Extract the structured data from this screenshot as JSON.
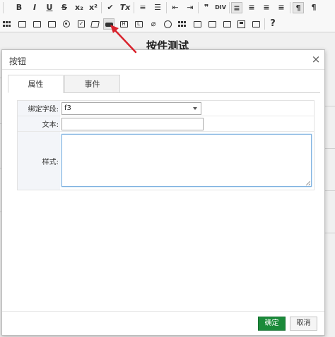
{
  "page": {
    "title": "按件测试"
  },
  "toolbar": {
    "row1": [
      {
        "name": "bold-icon",
        "glyph": "B"
      },
      {
        "name": "italic-icon",
        "glyph": "I"
      },
      {
        "name": "underline-icon",
        "glyph": "U"
      },
      {
        "name": "strikethrough-icon",
        "glyph": "S"
      },
      {
        "name": "subscript-icon",
        "glyph": "x₂"
      },
      {
        "name": "superscript-icon",
        "glyph": "x²"
      },
      {
        "name": "format-painter-icon",
        "glyph": "✔"
      },
      {
        "name": "remove-format-icon",
        "glyph": "Tx"
      },
      {
        "name": "numbered-list-icon",
        "glyph": "≡"
      },
      {
        "name": "bulleted-list-icon",
        "glyph": "☰"
      },
      {
        "name": "decrease-indent-icon",
        "glyph": "⇤"
      },
      {
        "name": "increase-indent-icon",
        "glyph": "⇥"
      },
      {
        "name": "blockquote-icon",
        "glyph": "❞"
      },
      {
        "name": "div-container-icon",
        "glyph": "DIV"
      },
      {
        "name": "align-left-icon",
        "glyph": "≡"
      },
      {
        "name": "align-center-icon",
        "glyph": "≡"
      },
      {
        "name": "align-right-icon",
        "glyph": "≡"
      },
      {
        "name": "justify-icon",
        "glyph": "≡"
      },
      {
        "name": "ltr-icon",
        "glyph": "¶"
      },
      {
        "name": "rtl-icon",
        "glyph": "¶"
      }
    ],
    "row2": [
      {
        "name": "table-icon"
      },
      {
        "name": "form-icon"
      },
      {
        "name": "select-icon"
      },
      {
        "name": "radio-icon"
      },
      {
        "name": "checkbox-icon"
      },
      {
        "name": "textarea-icon"
      },
      {
        "name": "button-icon"
      },
      {
        "name": "hidden-field-icon"
      },
      {
        "name": "label-icon"
      },
      {
        "name": "attachment-icon"
      },
      {
        "name": "time-icon"
      },
      {
        "name": "grid-control-icon"
      },
      {
        "name": "image-button-icon"
      },
      {
        "name": "signature-icon"
      },
      {
        "name": "data-control-icon"
      },
      {
        "name": "save-icon"
      },
      {
        "name": "layout-icon"
      },
      {
        "name": "help-icon",
        "glyph": "?"
      }
    ]
  },
  "dialog": {
    "title": "按钮",
    "close_glyph": "×",
    "tabs": [
      {
        "label": "属性",
        "active": true
      },
      {
        "label": "事件",
        "active": false
      }
    ],
    "fields": {
      "bind_field": {
        "label": "绑定字段:",
        "value": "f3"
      },
      "text": {
        "label": "文本:",
        "value": ""
      },
      "style": {
        "label": "样式:",
        "value": ""
      }
    },
    "buttons": {
      "ok": "确定",
      "cancel": "取消"
    }
  },
  "colors": {
    "ok_button": "#1b8a3a",
    "arrow": "#d9232d",
    "textarea_focus_border": "#7fb2e0",
    "label_background": "#f3f5f9"
  }
}
